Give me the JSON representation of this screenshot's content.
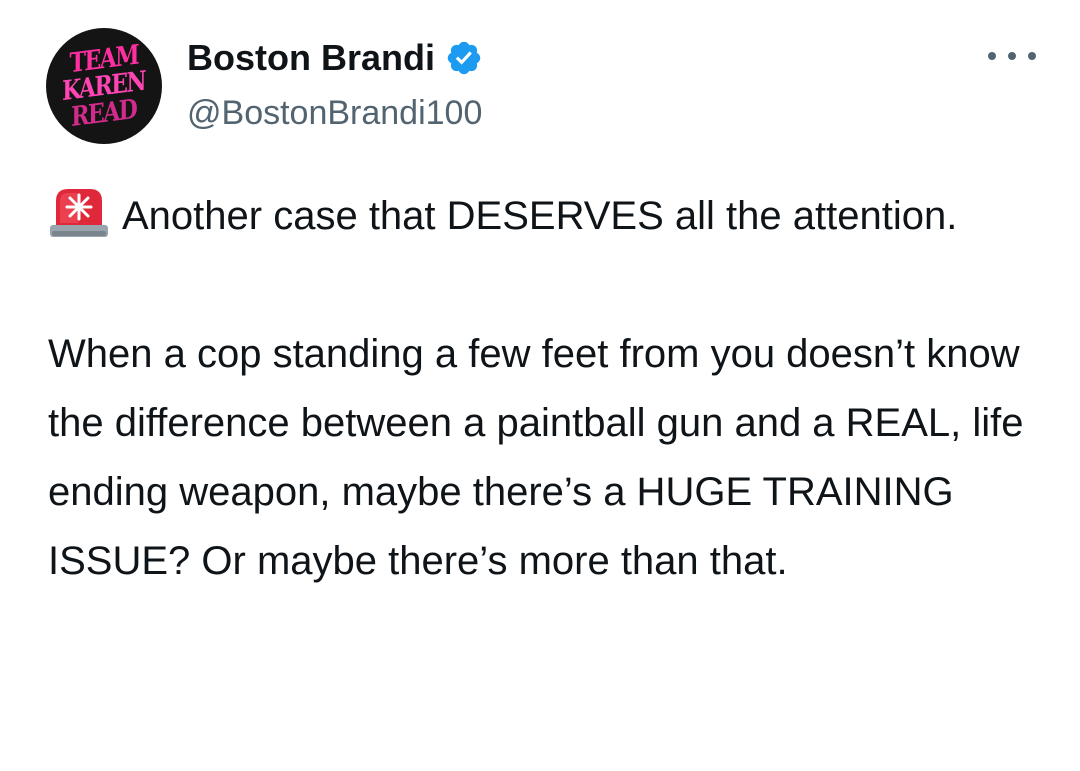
{
  "author": {
    "display_name": "Boston Brandi",
    "handle": "@BostonBrandi100",
    "verified": true,
    "avatar": {
      "lines": [
        "TEAM",
        "KAREN",
        "READ"
      ],
      "text_color": "#ff2fa2",
      "background": "#141414"
    }
  },
  "actions": {
    "more_icon": "ellipsis-icon"
  },
  "tweet": {
    "lead_icon": "police-light-icon",
    "paragraphs": [
      "Another case that DESERVES all the attention.",
      "When a cop standing a few feet from you doesn’t know the difference between a paintball gun and a REAL, life ending weapon, maybe there’s a HUGE TRAINING ISSUE? Or maybe there’s more than that."
    ]
  },
  "colors": {
    "text": "#0f1419",
    "secondary_text": "#536471",
    "verified_badge": "#1d9bf0"
  }
}
